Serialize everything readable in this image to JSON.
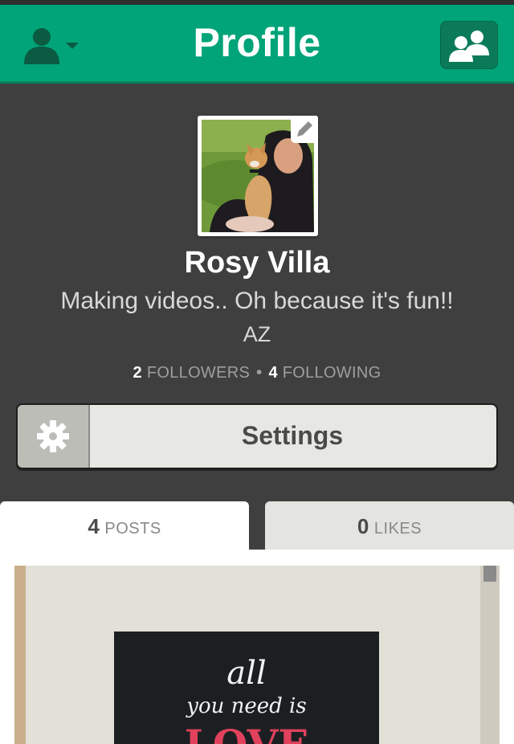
{
  "header": {
    "title": "Profile",
    "user_menu_icon": "user-dropdown-icon",
    "friends_icon": "add-friends-icon"
  },
  "profile": {
    "name": "Rosy Villa",
    "bio": "Making videos.. Oh because it's fun!!",
    "location": "AZ",
    "followers_count": "2",
    "followers_label": "FOLLOWERS",
    "separator": "•",
    "following_count": "4",
    "following_label": "FOLLOWING",
    "edit_icon": "pencil-icon"
  },
  "settings": {
    "label": "Settings",
    "icon": "gear-icon"
  },
  "tabs": [
    {
      "count": "4",
      "label": "POSTS",
      "active": true
    },
    {
      "count": "0",
      "label": "LIKES",
      "active": false
    }
  ],
  "post": {
    "text_line1": "all",
    "text_line2": "you need is",
    "text_line3": "LOVE"
  },
  "colors": {
    "accent": "#00a478",
    "background": "#3f3f3f"
  }
}
